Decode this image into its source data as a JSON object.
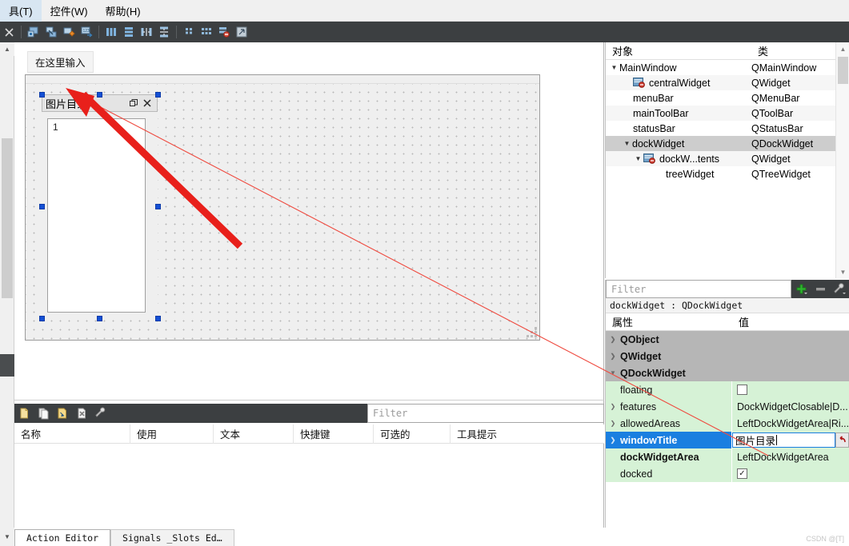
{
  "menubar": {
    "items": [
      {
        "label": "具(T)",
        "mnemonic": "T"
      },
      {
        "label": "控件(W)",
        "mnemonic": "W"
      },
      {
        "label": "帮助(H)",
        "mnemonic": "H"
      }
    ]
  },
  "toolbar": {
    "icons": [
      {
        "name": "close-icon",
        "glyph": "✕"
      },
      {
        "name": "edit-widgets-icon",
        "glyph": "▣"
      },
      {
        "name": "edit-signals-slots-icon",
        "glyph": "◪"
      },
      {
        "name": "edit-buddies-icon",
        "glyph": "◈"
      },
      {
        "name": "edit-tab-order-icon",
        "glyph": "⊞"
      },
      {
        "name": "layout-horizontally-icon",
        "glyph": "|||"
      },
      {
        "name": "layout-vertically-icon",
        "glyph": "≡"
      },
      {
        "name": "layout-splitter-horizontal-icon",
        "glyph": "⋈"
      },
      {
        "name": "layout-splitter-vertical-icon",
        "glyph": "⧖"
      },
      {
        "name": "layout-form-icon",
        "glyph": "⋮⋮"
      },
      {
        "name": "layout-grid-icon",
        "glyph": "⦙⦙⦙"
      },
      {
        "name": "break-layout-icon",
        "glyph": "⊟"
      },
      {
        "name": "adjust-size-icon",
        "glyph": "◲"
      }
    ]
  },
  "canvas": {
    "menu_placeholder": "在这里输入",
    "dock": {
      "title": "图片目录",
      "float_icon": "float-icon",
      "close_icon": "close-icon",
      "tree_header": "1"
    }
  },
  "object_inspector": {
    "columns": [
      "对象",
      "类"
    ],
    "rows": [
      {
        "name": "MainWindow",
        "class": "QMainWindow",
        "indent": 0,
        "expander": "▾",
        "icon": "",
        "selected": false
      },
      {
        "name": "centralWidget",
        "class": "QWidget",
        "indent": 1,
        "expander": "",
        "icon": "widget-icon",
        "selected": false
      },
      {
        "name": "menuBar",
        "class": "QMenuBar",
        "indent": 1,
        "expander": "",
        "icon": "",
        "selected": false
      },
      {
        "name": "mainToolBar",
        "class": "QToolBar",
        "indent": 1,
        "expander": "",
        "icon": "",
        "selected": false
      },
      {
        "name": "statusBar",
        "class": "QStatusBar",
        "indent": 1,
        "expander": "",
        "icon": "",
        "selected": false
      },
      {
        "name": "dockWidget",
        "class": "QDockWidget",
        "indent": 1,
        "expander": "▾",
        "icon": "",
        "selected": true
      },
      {
        "name": "dockW...tents",
        "class": "QWidget",
        "indent": 2,
        "expander": "▾",
        "icon": "widget-icon",
        "selected": false
      },
      {
        "name": "treeWidget",
        "class": "QTreeWidget",
        "indent": 3,
        "expander": "",
        "icon": "",
        "selected": false
      }
    ]
  },
  "property_editor": {
    "filter_placeholder": "Filter",
    "add_icon": "plus-icon",
    "remove_icon": "minus-icon",
    "config_icon": "wrench-icon",
    "object_line": "dockWidget : QDockWidget",
    "columns": [
      "属性",
      "值"
    ],
    "groups": [
      {
        "label": "QObject",
        "expander": "›"
      },
      {
        "label": "QWidget",
        "expander": "›"
      },
      {
        "label": "QDockWidget",
        "expander": "⌄"
      }
    ],
    "rows": [
      {
        "name": "floating",
        "value": "",
        "type": "checkbox",
        "checked": false,
        "expander": "",
        "bold": false,
        "selected": false
      },
      {
        "name": "features",
        "value": "DockWidgetClosable|D...",
        "type": "text",
        "expander": "›",
        "bold": false,
        "selected": false
      },
      {
        "name": "allowedAreas",
        "value": "LeftDockWidgetArea|Ri...",
        "type": "text",
        "expander": "›",
        "bold": false,
        "selected": false
      },
      {
        "name": "windowTitle",
        "value": "图片目录",
        "type": "editing",
        "expander": "›",
        "bold": true,
        "selected": true,
        "revert_icon": "revert-icon"
      },
      {
        "name": "dockWidgetArea",
        "value": "LeftDockWidgetArea",
        "type": "text",
        "expander": "",
        "bold": true,
        "selected": false
      },
      {
        "name": "docked",
        "value": "",
        "type": "checkbox",
        "checked": true,
        "expander": "",
        "bold": false,
        "selected": false
      }
    ]
  },
  "action_editor": {
    "icons": [
      {
        "name": "new-action-icon",
        "glyph": "▯"
      },
      {
        "name": "copy-action-icon",
        "glyph": "❐"
      },
      {
        "name": "edit-action-icon",
        "glyph": "✎"
      },
      {
        "name": "delete-action-icon",
        "glyph": "✖"
      },
      {
        "name": "view-options-icon",
        "glyph": "🔧"
      }
    ],
    "filter_placeholder": "Filter",
    "columns": [
      "名称",
      "使用",
      "文本",
      "快捷键",
      "可选的",
      "工具提示"
    ]
  },
  "bottom_tabs": {
    "tabs": [
      {
        "label": "Action Editor",
        "active": true
      },
      {
        "label": "Signals _Slots Ed…",
        "active": false
      }
    ]
  },
  "watermark": "CSDN @[T]",
  "colors": {
    "toolbar_bg": "#3c3f41",
    "selection_blue": "#1a7fe0",
    "property_green": "#d6f2d6",
    "group_gray": "#b6b6b6",
    "annotation_red": "#e8201b",
    "handle_blue": "#1450d4"
  }
}
